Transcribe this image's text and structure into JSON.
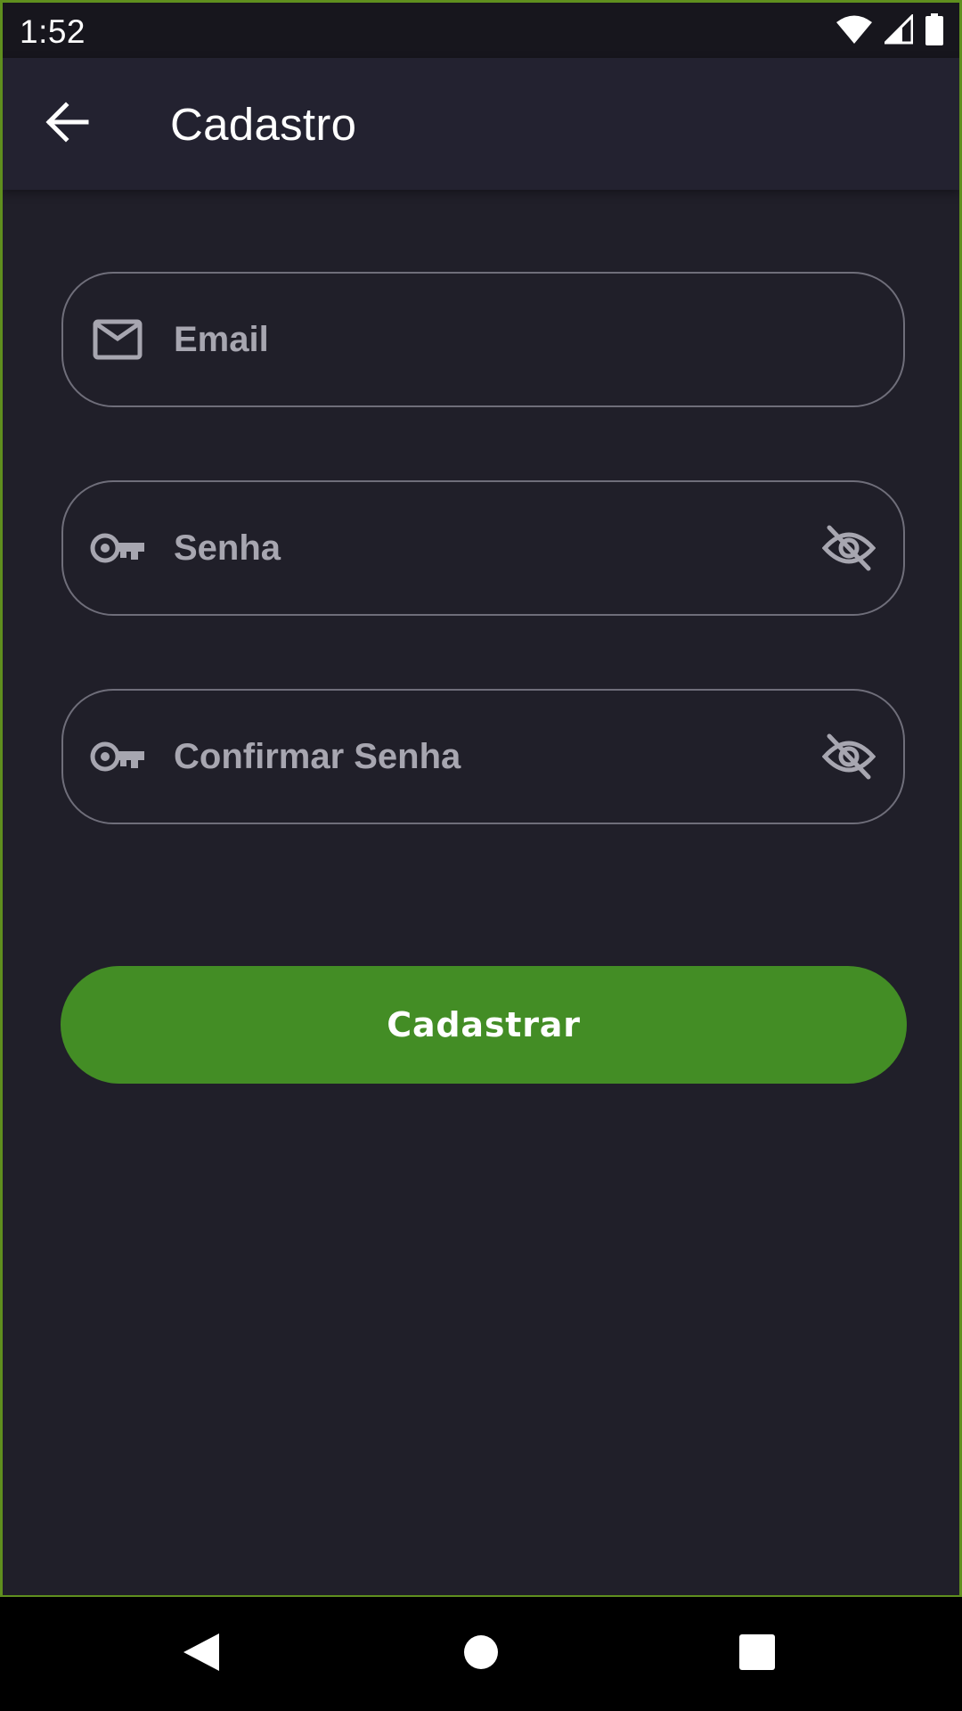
{
  "status_bar": {
    "time": "1:52",
    "icons": [
      "wifi-icon",
      "cell-signal-icon",
      "battery-icon"
    ]
  },
  "app_bar": {
    "title": "Cadastro",
    "back_icon": "arrow-back-icon"
  },
  "form": {
    "email": {
      "placeholder": "Email",
      "value": "",
      "icon": "mail-icon"
    },
    "password": {
      "placeholder": "Senha",
      "value": "",
      "icon": "key-icon",
      "toggle_icon": "visibility-off-icon"
    },
    "confirm_password": {
      "placeholder": "Confirmar Senha",
      "value": "",
      "icon": "key-icon",
      "toggle_icon": "visibility-off-icon"
    },
    "submit_label": "Cadastrar"
  },
  "nav_bar": {
    "icons": [
      "nav-back-icon",
      "nav-home-icon",
      "nav-recents-icon"
    ]
  },
  "colors": {
    "background": "#201f29",
    "app_bar": "#232230",
    "accent": "#438d25",
    "field_border": "#6f6e7a",
    "placeholder": "#a7a6b0"
  }
}
